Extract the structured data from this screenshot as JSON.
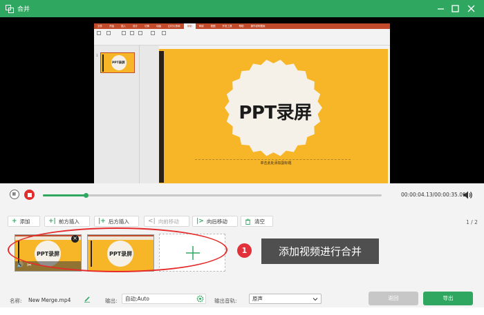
{
  "window": {
    "title": "合并"
  },
  "ppt": {
    "tabs": [
      "文件",
      "开始",
      "插入",
      "设计",
      "切换",
      "动画",
      "幻灯片放映",
      "录制",
      "审阅",
      "视图",
      "开发工具",
      "帮助",
      "操作说明搜索"
    ],
    "active_tab_index": 7,
    "thumb_number": "1",
    "thumb_title": "PPT录屏",
    "slide_title": "PPT录屏",
    "slide_subtitle": "单击此处添加副标题",
    "theme_color": "#f7b628",
    "accent_color": "#c14a2a"
  },
  "player": {
    "progress_fraction": 0.128,
    "time": "00:00:04.13/00:00:35.09"
  },
  "toolbar": {
    "add": "添加",
    "insert_before": "前方插入",
    "insert_after": "后方插入",
    "move_forward": "向前移动",
    "move_backward": "向后移动",
    "clear": "清空",
    "page_count": "1 / 2"
  },
  "clips": [
    {
      "title": "PPT录屏"
    },
    {
      "title": "PPT录屏"
    }
  ],
  "annotation": {
    "step": "1",
    "text": "添加视频进行合并"
  },
  "bottom": {
    "name_label": "名称:",
    "name_value": "New Merge.mp4",
    "output_label": "输出:",
    "output_value": "自动;Auto",
    "audio_label": "输出音轨:",
    "audio_value": "原声",
    "back_button": "返回",
    "export_button": "导出"
  },
  "colors": {
    "brand": "#2fa760",
    "record": "#e22d2d"
  }
}
